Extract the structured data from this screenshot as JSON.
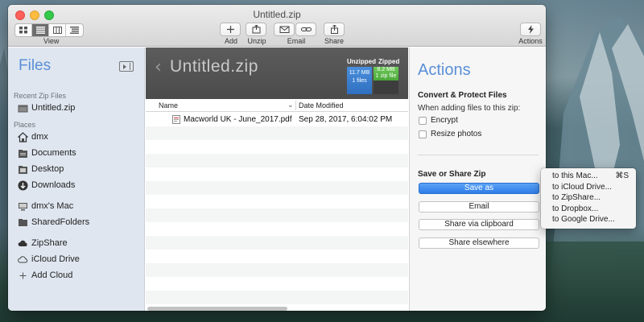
{
  "window": {
    "title": "Untitled.zip"
  },
  "toolbar": {
    "view_label": "View",
    "add_label": "Add",
    "unzip_label": "Unzip",
    "email_label": "Email",
    "share_label": "Share",
    "actions_label": "Actions"
  },
  "sidebar": {
    "title": "Files",
    "recent_header": "Recent Zip Files",
    "recent_items": [
      {
        "label": "Untitled.zip",
        "icon": "zip-archive-icon"
      }
    ],
    "places_header": "Places",
    "places": [
      {
        "label": "dmx",
        "icon": "home-icon"
      },
      {
        "label": "Documents",
        "icon": "documents-icon"
      },
      {
        "label": "Desktop",
        "icon": "desktop-icon"
      },
      {
        "label": "Downloads",
        "icon": "downloads-icon"
      },
      {
        "label": "dmx's Mac",
        "icon": "computer-icon"
      },
      {
        "label": "SharedFolders",
        "icon": "folder-icon"
      }
    ],
    "cloud": [
      {
        "label": "ZipShare",
        "icon": "cloud-filled-icon"
      },
      {
        "label": "iCloud Drive",
        "icon": "cloud-outline-icon"
      },
      {
        "label": "Add Cloud",
        "icon": "plus-icon"
      }
    ]
  },
  "main": {
    "zip_name": "Untitled.zip",
    "unzipped_label": "Unzipped",
    "zipped_label": "Zipped",
    "unzipped_size": "11.7 MB",
    "unzipped_files": "1 files",
    "zipped_size": "8.2 MB",
    "zipped_files": "1 zip file",
    "columns": {
      "name": "Name",
      "date": "Date Modified"
    },
    "files": [
      {
        "name": "Macworld UK - June_2017.pdf",
        "date": "Sep 28, 2017, 6:04:02 PM"
      }
    ]
  },
  "actions": {
    "title": "Actions",
    "convert_header": "Convert & Protect Files",
    "convert_sub": "When adding files to this zip:",
    "encrypt_label": "Encrypt",
    "resize_label": "Resize photos",
    "save_header": "Save or Share Zip",
    "save_as_label": "Save as",
    "email_label": "Email",
    "clipboard_label": "Share via clipboard",
    "elsewhere_label": "Share elsewhere"
  },
  "menu": {
    "items": [
      {
        "label": "to this Mac...",
        "shortcut": "⌘S"
      },
      {
        "label": "to iCloud Drive..."
      },
      {
        "label": "to ZipShare..."
      },
      {
        "label": "to Dropbox..."
      },
      {
        "label": "to Google Drive..."
      }
    ]
  },
  "colors": {
    "accent": "#5a8fd8",
    "unzipped": "#3a7fd0",
    "zipped": "#5cb848",
    "primary_button": "#3a88ee"
  }
}
